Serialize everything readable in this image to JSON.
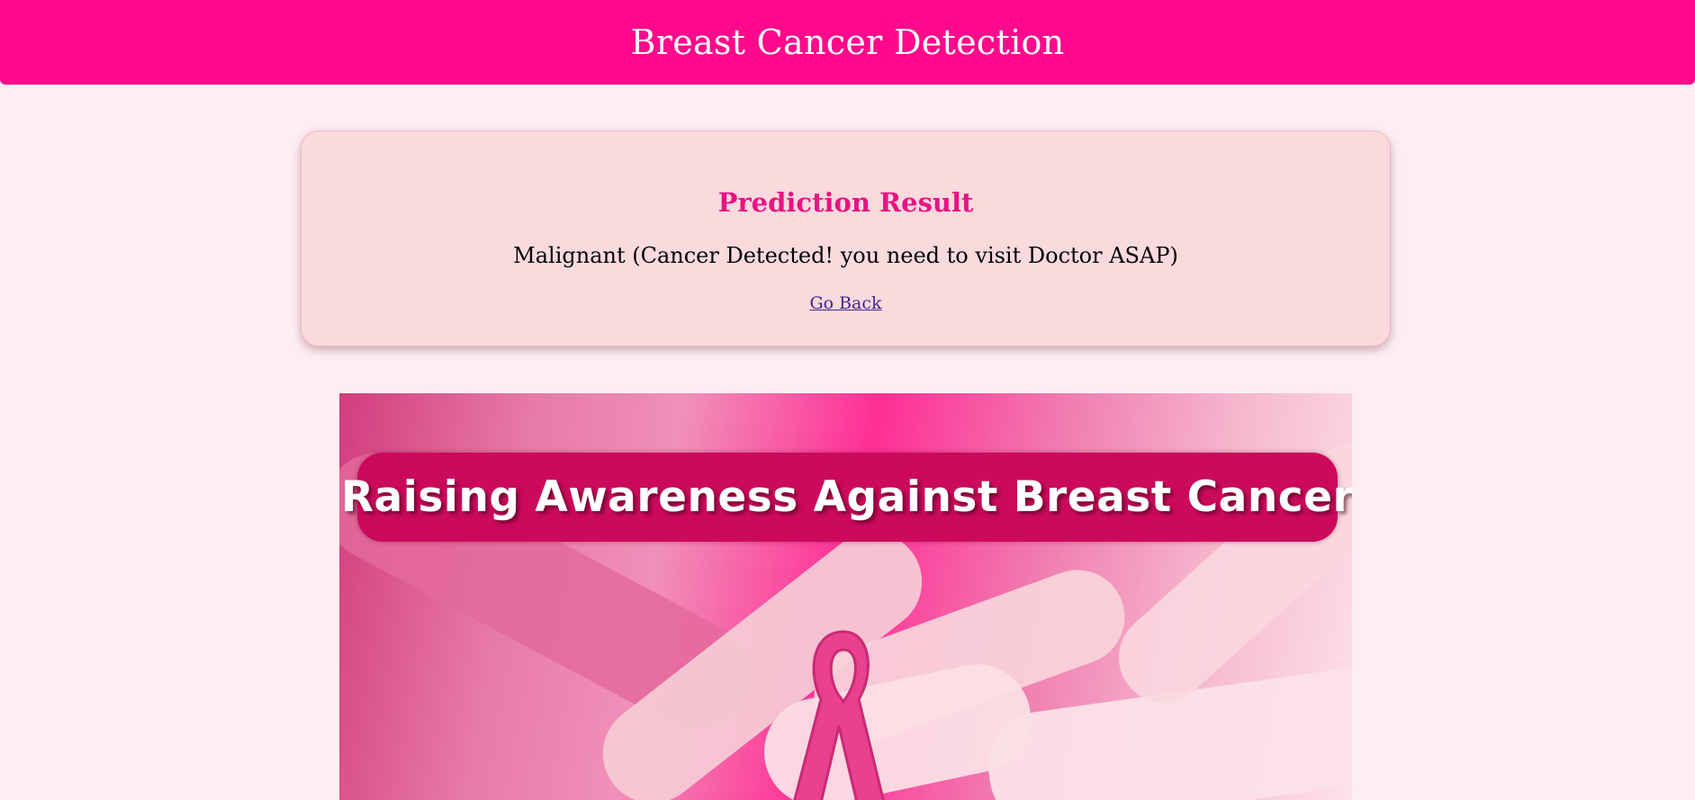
{
  "header": {
    "title": "Breast Cancer Detection",
    "background_color": "#ff0a8c"
  },
  "result_card": {
    "heading": "Prediction Result",
    "prediction": "Malignant (Cancer Detected! you need to visit Doctor ASAP)",
    "back_link_label": "Go Back",
    "heading_color": "#ea1283",
    "card_background": "#fbdadd"
  },
  "banner": {
    "caption": "Raising Awareness Against Breast Cancer",
    "ribbon_icon": "pink-ribbon-icon",
    "caption_background": "#cc0a5c"
  },
  "page": {
    "background_color": "#fdeef3"
  }
}
